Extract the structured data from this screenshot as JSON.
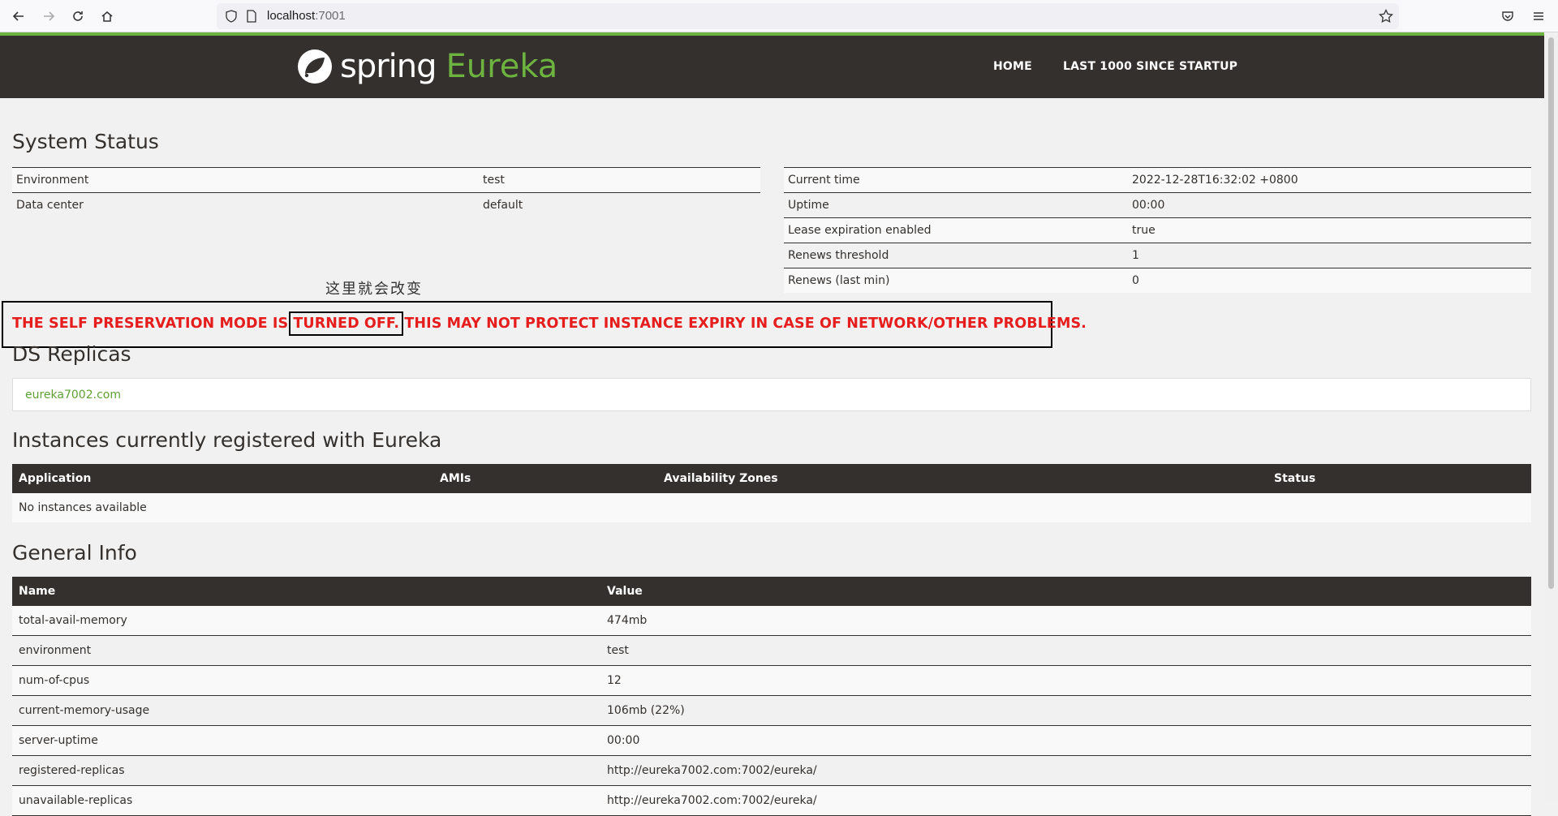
{
  "browser": {
    "url_host": "localhost",
    "url_port": ":7001"
  },
  "nav": {
    "logo_spring": "spring",
    "logo_eureka": "Eureka",
    "home": "HOME",
    "last1000": "LAST 1000 SINCE STARTUP"
  },
  "system_status": {
    "title": "System Status",
    "left": [
      {
        "label": "Environment",
        "value": "test"
      },
      {
        "label": "Data center",
        "value": "default"
      }
    ],
    "right": [
      {
        "label": "Current time",
        "value": "2022-12-28T16:32:02 +0800"
      },
      {
        "label": "Uptime",
        "value": "00:00"
      },
      {
        "label": "Lease expiration enabled",
        "value": "true"
      },
      {
        "label": "Renews threshold",
        "value": "1"
      },
      {
        "label": "Renews (last min)",
        "value": "0"
      }
    ]
  },
  "annotation": {
    "note": "这里就会改变"
  },
  "warning": {
    "before": "THE SELF PRESERVATION MODE IS ",
    "highlight": "TURNED OFF.",
    "after": " THIS MAY NOT PROTECT INSTANCE EXPIRY IN CASE OF NETWORK/OTHER PROBLEMS."
  },
  "ds_replicas": {
    "title": "DS Replicas",
    "link": "eureka7002.com"
  },
  "instances": {
    "title": "Instances currently registered with Eureka",
    "headers": [
      "Application",
      "AMIs",
      "Availability Zones",
      "Status"
    ],
    "empty": "No instances available"
  },
  "general_info": {
    "title": "General Info",
    "headers": [
      "Name",
      "Value"
    ],
    "rows": [
      {
        "name": "total-avail-memory",
        "value": "474mb"
      },
      {
        "name": "environment",
        "value": "test"
      },
      {
        "name": "num-of-cpus",
        "value": "12"
      },
      {
        "name": "current-memory-usage",
        "value": "106mb (22%)"
      },
      {
        "name": "server-uptime",
        "value": "00:00"
      },
      {
        "name": "registered-replicas",
        "value": "http://eureka7002.com:7002/eureka/"
      },
      {
        "name": "unavailable-replicas",
        "value": "http://eureka7002.com:7002/eureka/"
      }
    ]
  }
}
